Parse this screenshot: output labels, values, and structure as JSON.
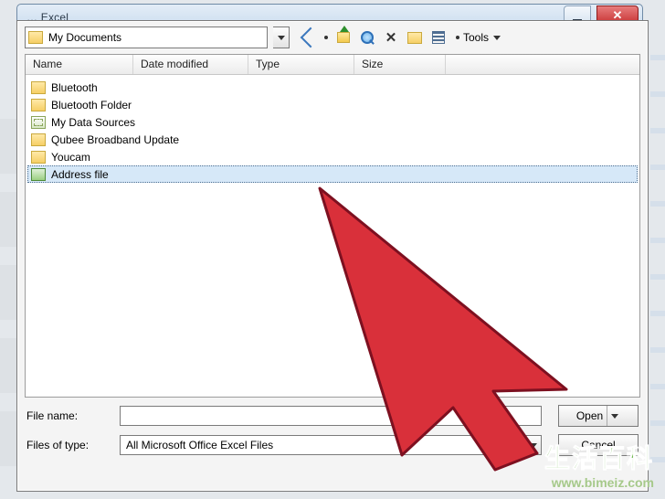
{
  "window": {
    "title": "… Excel"
  },
  "toolbar": {
    "location_label": "My Documents",
    "tools_label": "Tools",
    "icons": {
      "back": "back-icon",
      "up": "folder-up-icon",
      "search": "search-icon",
      "delete": "delete-icon",
      "newfolder": "new-folder-icon",
      "views": "views-icon"
    }
  },
  "columns": {
    "name": "Name",
    "date": "Date modified",
    "type": "Type",
    "size": "Size"
  },
  "files": [
    {
      "name": "Bluetooth",
      "kind": "folder",
      "selected": false
    },
    {
      "name": "Bluetooth Folder",
      "kind": "folder",
      "selected": false
    },
    {
      "name": "My Data Sources",
      "kind": "db",
      "selected": false
    },
    {
      "name": "Qubee Broadband Update",
      "kind": "folder",
      "selected": false
    },
    {
      "name": "Youcam",
      "kind": "folder",
      "selected": false
    },
    {
      "name": "Address file",
      "kind": "xls",
      "selected": true
    }
  ],
  "fields": {
    "file_name_label": "File name:",
    "file_name_value": "",
    "file_type_label": "Files of type:",
    "file_type_value": "All Microsoft Office Excel Files"
  },
  "buttons": {
    "open": "Open",
    "cancel": "Cancel"
  },
  "watermark": {
    "cn": "生活百科",
    "url": "www.bimeiz.com"
  }
}
